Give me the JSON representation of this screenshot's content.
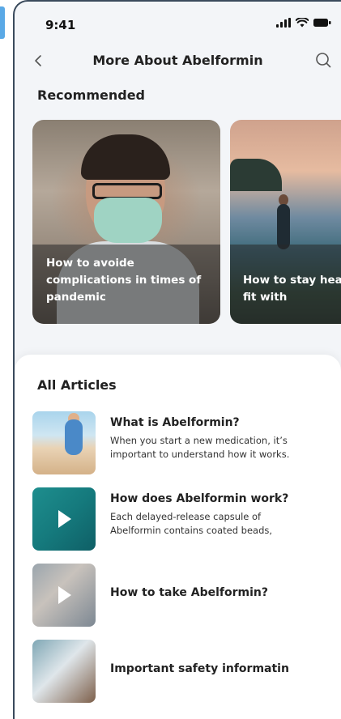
{
  "status_bar": {
    "time": "9:41"
  },
  "nav": {
    "title": "More About Abelformin"
  },
  "recommended": {
    "title": "Recommended",
    "cards": [
      {
        "caption_lines": [
          "How to avoide",
          "complications in times of",
          "pandemic"
        ]
      },
      {
        "caption_lines": [
          "How to stay hea",
          "fit with"
        ]
      }
    ]
  },
  "all_articles": {
    "title": "All Articles",
    "items": [
      {
        "title": "What is Abelformin?",
        "desc_lines": [
          "When you start a new medication, it’s",
          "important to understand how it works."
        ]
      },
      {
        "title": "How does Abelformin work?",
        "desc_lines": [
          "Each delayed-release capsule of",
          "Abelformin contains coated beads,"
        ]
      },
      {
        "title": "How to take Abelformin?"
      },
      {
        "title": "Important safety informatin"
      }
    ]
  },
  "colors": {
    "background": "#f3f5f8",
    "panel": "#ffffff",
    "text": "#222222",
    "accent_teal": "#157a7d"
  }
}
